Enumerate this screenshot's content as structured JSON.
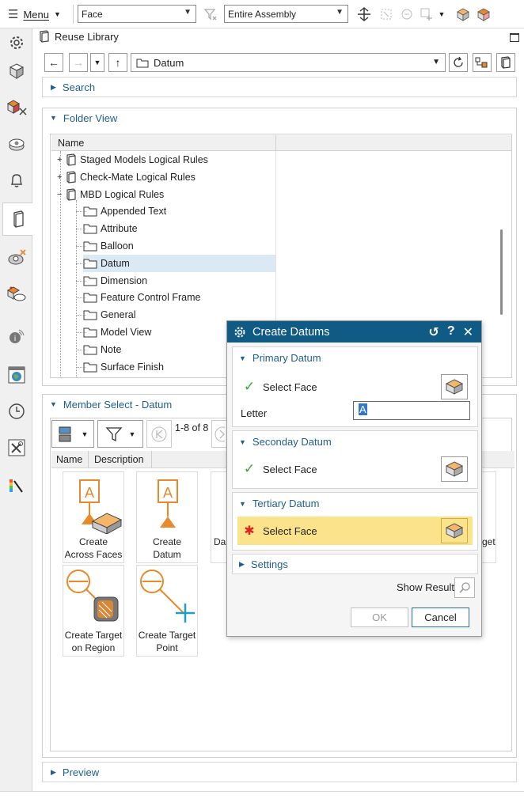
{
  "toolbar": {
    "menu_label": "Menu",
    "filter_type": "Face",
    "scope": "Entire Assembly"
  },
  "panel": {
    "title": "Reuse Library",
    "path": "Datum"
  },
  "sections": {
    "search": "Search",
    "folder_view": "Folder View",
    "member_select": "Member Select - Datum",
    "preview": "Preview"
  },
  "folder_table": {
    "column_name": "Name",
    "rows": [
      {
        "label": "Staged Models Logical Rules",
        "level": 0,
        "expander": "+"
      },
      {
        "label": "Check-Mate Logical Rules",
        "level": 0,
        "expander": "+"
      },
      {
        "label": "MBD Logical Rules",
        "level": 0,
        "expander": "-"
      },
      {
        "label": "Appended Text",
        "level": 1
      },
      {
        "label": "Attribute",
        "level": 1
      },
      {
        "label": "Balloon",
        "level": 1
      },
      {
        "label": "Datum",
        "level": 1,
        "selected": true
      },
      {
        "label": "Dimension",
        "level": 1
      },
      {
        "label": "Feature Control Frame",
        "level": 1
      },
      {
        "label": "General",
        "level": 1
      },
      {
        "label": "Model View",
        "level": 1
      },
      {
        "label": "Note",
        "level": 1
      },
      {
        "label": "Surface Finish",
        "level": 1
      }
    ]
  },
  "member_select": {
    "count_label": "1-8 of 8",
    "col_name": "Name",
    "col_description": "Description",
    "tiles": [
      {
        "line1": "Create",
        "line2": "Across Faces"
      },
      {
        "line1": "Create",
        "line2": "Datum"
      },
      {
        "line1": "Da",
        "line2": ""
      },
      {
        "line1": "get",
        "line2": ""
      },
      {
        "line1": "Create Target",
        "line2": "on Region"
      },
      {
        "line1": "Create Target",
        "line2": "Point"
      }
    ]
  },
  "dialog": {
    "title": "Create Datums",
    "primary": {
      "heading": "Primary Datum",
      "select_label": "Select Face",
      "letter_label": "Letter",
      "letter_value": "A"
    },
    "secondary": {
      "heading": "Seconday Datum",
      "select_label": "Select Face"
    },
    "tertiary": {
      "heading": "Tertiary Datum",
      "select_label": "Select Face"
    },
    "settings": "Settings",
    "show_result": "Show Result",
    "ok": "OK",
    "cancel": "Cancel"
  },
  "colors": {
    "accent_blue": "#1f5f8f",
    "dialog_title": "#0f5b85",
    "highlight_yellow": "#fae38b",
    "selection_blue": "#dbe9f5",
    "orange": "#e8892b",
    "teal": "#1aa0c8"
  },
  "icons": {
    "rail": [
      "gear-icon",
      "cube-icon",
      "assembly-icon",
      "part-icon",
      "bell-icon",
      "library-book-icon",
      "shape-icon",
      "constraint-icon",
      "info-icon",
      "globe-window-icon",
      "clock-icon",
      "tools-icon",
      "palette-icon"
    ]
  }
}
